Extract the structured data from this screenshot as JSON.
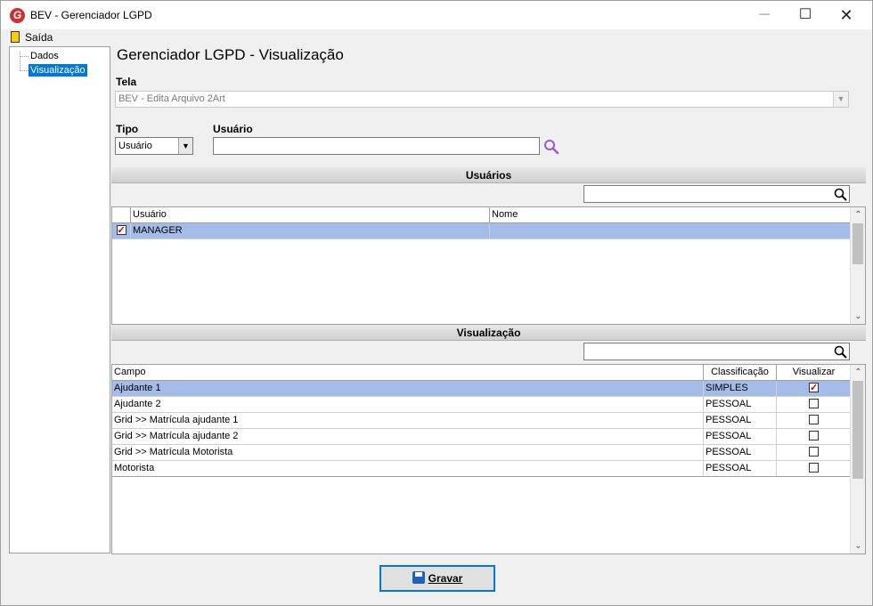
{
  "window": {
    "title": "BEV - Gerenciador LGPD",
    "icon": "app-g-logo-icon",
    "min": "─",
    "max": "☐",
    "close": "✕"
  },
  "menu": {
    "exit_label": "Saída"
  },
  "tree": {
    "items": [
      {
        "label": "Dados"
      },
      {
        "label": "Visualização"
      }
    ]
  },
  "page": {
    "title": "Gerenciador LGPD - Visualização"
  },
  "tela": {
    "label": "Tela",
    "value": "BEV - Edita Arquivo 2Art"
  },
  "tipo": {
    "label": "Tipo",
    "value": "Usuário"
  },
  "usuario": {
    "label": "Usuário",
    "value": ""
  },
  "usuarios_section": {
    "title": "Usuários",
    "filter_value": "",
    "columns": [
      "Usuário",
      "Nome"
    ],
    "rows": [
      {
        "checked": true,
        "usuario": "MANAGER",
        "nome": ""
      }
    ]
  },
  "visualizacao_section": {
    "title": "Visualização",
    "filter_value": "",
    "columns": [
      "Campo",
      "Classificação",
      "Visualizar"
    ],
    "rows": [
      {
        "campo": "Ajudante 1",
        "classificacao": "SIMPLES",
        "visualizar": true
      },
      {
        "campo": "Ajudante 2",
        "classificacao": "PESSOAL",
        "visualizar": false
      },
      {
        "campo": "Grid >> Matrícula ajudante 1",
        "classificacao": "PESSOAL",
        "visualizar": false
      },
      {
        "campo": "Grid >> Matrícula ajudante 2",
        "classificacao": "PESSOAL",
        "visualizar": false
      },
      {
        "campo": "Grid >> Matrícula Motorista",
        "classificacao": "PESSOAL",
        "visualizar": false
      },
      {
        "campo": "Motorista",
        "classificacao": "PESSOAL",
        "visualizar": false
      }
    ]
  },
  "actions": {
    "save_label": "Gravar"
  },
  "colors": {
    "selection": "#a4bde8",
    "tree_selection": "#0078d7",
    "check_mark": "#d00000",
    "search_icon_purple": "#9b59d0"
  }
}
